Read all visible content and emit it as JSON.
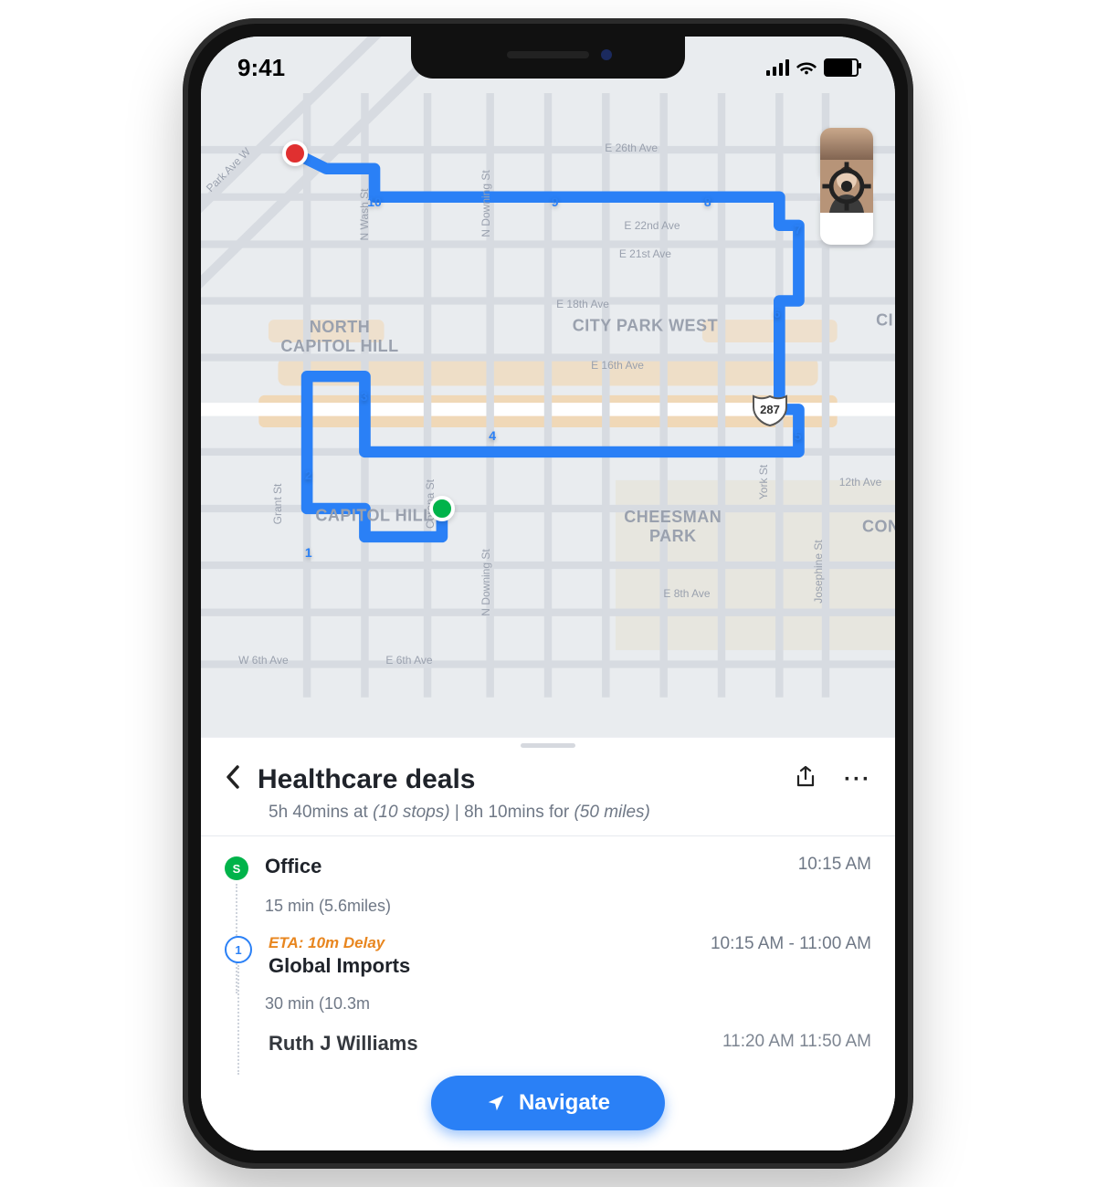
{
  "status": {
    "time": "9:41"
  },
  "map": {
    "neighborhoods": {
      "nch": "NORTH\nCAPITOL HILL",
      "cpw": "CITY PARK WEST",
      "ch": "CAPITOL HILL",
      "cp": "CHEESMAN\nPARK",
      "ci": "CI",
      "con": "CON"
    },
    "streets": {
      "e26": "E 26th Ave",
      "e22": "E 22nd Ave",
      "e21": "E 21st Ave",
      "e18": "E 18th Ave",
      "e16": "E 16th Ave",
      "e12": "12th Ave",
      "e8": "E 8th Ave",
      "e6": "E 6th Ave",
      "w6": "W 6th Ave",
      "park": "Park Ave W",
      "nwash": "N Wash St",
      "ndown": "N Downing St",
      "ndown2": "N Downing St",
      "grant": "Grant St",
      "corona": "Corona St",
      "york": "York St",
      "jos": "Josephine St"
    },
    "highway": "287",
    "pins": {
      "p1": "1",
      "p2": "2",
      "p3": "3",
      "p4": "4",
      "p5": "5",
      "p6": "6",
      "p7": "7",
      "p8": "8",
      "p9": "9",
      "p10": "10"
    }
  },
  "sheet": {
    "title": "Healthcare deals",
    "sub_a": "5h 40mins at ",
    "sub_b": "(10 stops)",
    "sub_sep": "   |   ",
    "sub_c": "8h 10mins for ",
    "sub_d": "(50 miles)",
    "nav": "Navigate"
  },
  "stops": {
    "start_badge": "S",
    "start_name": "Office",
    "start_time": "10:15 AM",
    "seg1": "15 min (5.6miles)",
    "s1_badge": "1",
    "s1_eta": "ETA: 10m Delay",
    "s1_name": "Global Imports",
    "s1_time": "10:15 AM - 11:00 AM",
    "seg2": "30 min (10.3m",
    "s2_name": "Ruth J Williams",
    "s2_time": "11:20 AM   11:50 AM"
  }
}
